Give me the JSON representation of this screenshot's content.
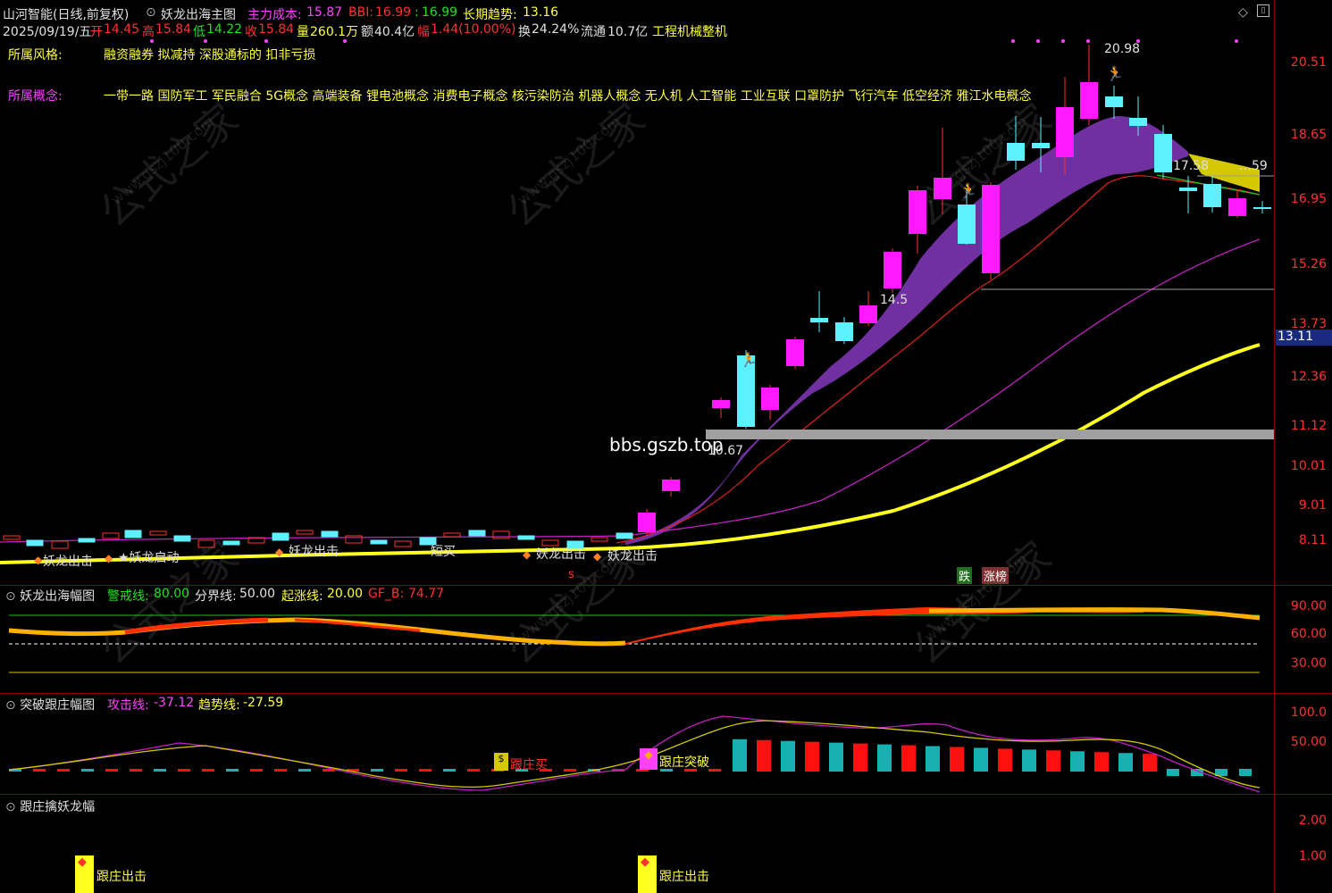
{
  "header": {
    "stock_name": "山河智能(日线,前复权)",
    "indicator_dropdown_icon": "chevron-down-icon",
    "indicator_name": "妖龙出海主图",
    "main_cost_label": "主力成本:",
    "main_cost_value": "15.87",
    "bbi_label": "BBI:",
    "bbi_value": "16.99",
    "bbi_sep": ":",
    "bbi_value2": "16.99",
    "long_trend_label": "长期趋势:",
    "long_trend_value": "13.16"
  },
  "quote": {
    "date": "2025/09/19/五",
    "open_label": "开",
    "open": "14.45",
    "high_label": "高",
    "high": "15.84",
    "low_label": "低",
    "low": "14.22",
    "close_label": "收",
    "close": "15.84",
    "volume_label": "量",
    "volume": "260.1万",
    "amount_label": "额",
    "amount": "40.4亿",
    "change_label": "幅",
    "change": "1.44(10.00%)",
    "turnover_label": "换",
    "turnover": "24.24%",
    "float_label": "流通",
    "float": "10.7亿",
    "industry": "工程机械整机"
  },
  "info": {
    "style_label": "所属风格:",
    "style_value": "融资融券 拟减持 深股通标的 扣非亏损",
    "concept_label": "所属概念:",
    "concept_value": "一带一路 国防军工 军民融合 5G概念 高端装备 锂电池概念 消费电子概念 核污染防治 机器人概念 无人机 人工智能 工业互联 口罩防护 飞行汽车 低空经济 雅江水电概念"
  },
  "main_axis": [
    "20.51",
    "18.65",
    "16.95",
    "15.26",
    "13.73",
    "12.36",
    "11.12",
    "10.01",
    "9.01",
    "8.11"
  ],
  "main_axis_current": "13.11",
  "annotations": {
    "high_price": "20.98",
    "level_1758": "17.58",
    "level_1758_b": "…59",
    "level_145": "14.5",
    "level_1067": "10.67",
    "site_text": "bbs.gszb.top",
    "signal_1": "妖龙出击",
    "signal_2": "★妖龙启动",
    "signal_3": "妖龙出击",
    "signal_4": "短买",
    "signal_5": "妖龙出击",
    "signal_6": "妖龙出击",
    "tag_down": "跌",
    "tag_up": "涨榜",
    "marker_s": "s"
  },
  "panel2": {
    "title": "妖龙出海幅图",
    "warn_label": "警戒线:",
    "warn_value": "80.00",
    "split_label": "分界线:",
    "split_value": "50.00",
    "rise_label": "起涨线:",
    "rise_value": "20.00",
    "gf_label": "GF_B:",
    "gf_value": "74.77",
    "axis": [
      "90.00",
      "60.00",
      "30.00"
    ]
  },
  "panel3": {
    "title": "突破跟庄幅图",
    "attack_label": "攻击线:",
    "attack_value": "-37.12",
    "trend_label": "趋势线:",
    "trend_value": "-27.59",
    "axis": [
      "100.0",
      "50.00"
    ],
    "signal_buy": "跟庄买",
    "signal_break": "跟庄突破"
  },
  "panel4": {
    "title": "跟庄擒妖龙幅",
    "axis": [
      "2.00",
      "1.00"
    ],
    "signal_out_1": "跟庄出击",
    "signal_out_2": "跟庄出击"
  },
  "watermark": {
    "cn": "公式之家",
    "url": "www.gszj100.com"
  },
  "colors": {
    "up": "#ff1aff",
    "down": "#5ff0ff",
    "trend_band": "#7030a0",
    "long_trend": "#ffff20",
    "ma_magenta": "#c020c0",
    "ma_red": "#e02020",
    "grid": "#8a0000"
  }
}
